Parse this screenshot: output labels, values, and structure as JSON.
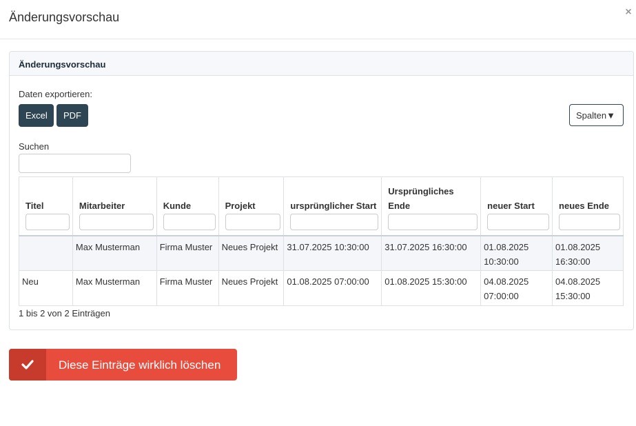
{
  "modal": {
    "title": "Änderungsvorschau",
    "close_label": "×"
  },
  "panel": {
    "heading": "Änderungsvorschau",
    "export_label": "Daten exportieren:",
    "export_buttons": [
      "Excel",
      "PDF"
    ],
    "columns_button": "Spalten▼",
    "search_label": "Suchen",
    "search_value": ""
  },
  "table": {
    "headers": [
      "Titel",
      "Mitarbeiter",
      "Kunde",
      "Projekt",
      "ursprünglicher Start",
      "Ursprüngliches Ende",
      "neuer Start",
      "neues Ende"
    ],
    "rows": [
      [
        "",
        "Max Musterman",
        "Firma Muster",
        "Neues Projekt",
        "31.07.2025 10:30:00",
        "31.07.2025 16:30:00",
        "01.08.2025 10:30:00",
        "01.08.2025 16:30:00"
      ],
      [
        "Neu",
        "Max Musterman",
        "Firma Muster",
        "Neues Projekt",
        "01.08.2025 07:00:00",
        "01.08.2025 15:30:00",
        "04.08.2025 07:00:00",
        "04.08.2025 15:30:00"
      ]
    ],
    "info": "1 bis 2 von 2 Einträgen"
  },
  "delete_button": {
    "label": "Diese Einträge wirklich löschen",
    "icon": "check-icon"
  },
  "colors": {
    "dark_button": "#2e4553",
    "danger": "#e74c3c",
    "danger_dark": "#c73b2d"
  }
}
